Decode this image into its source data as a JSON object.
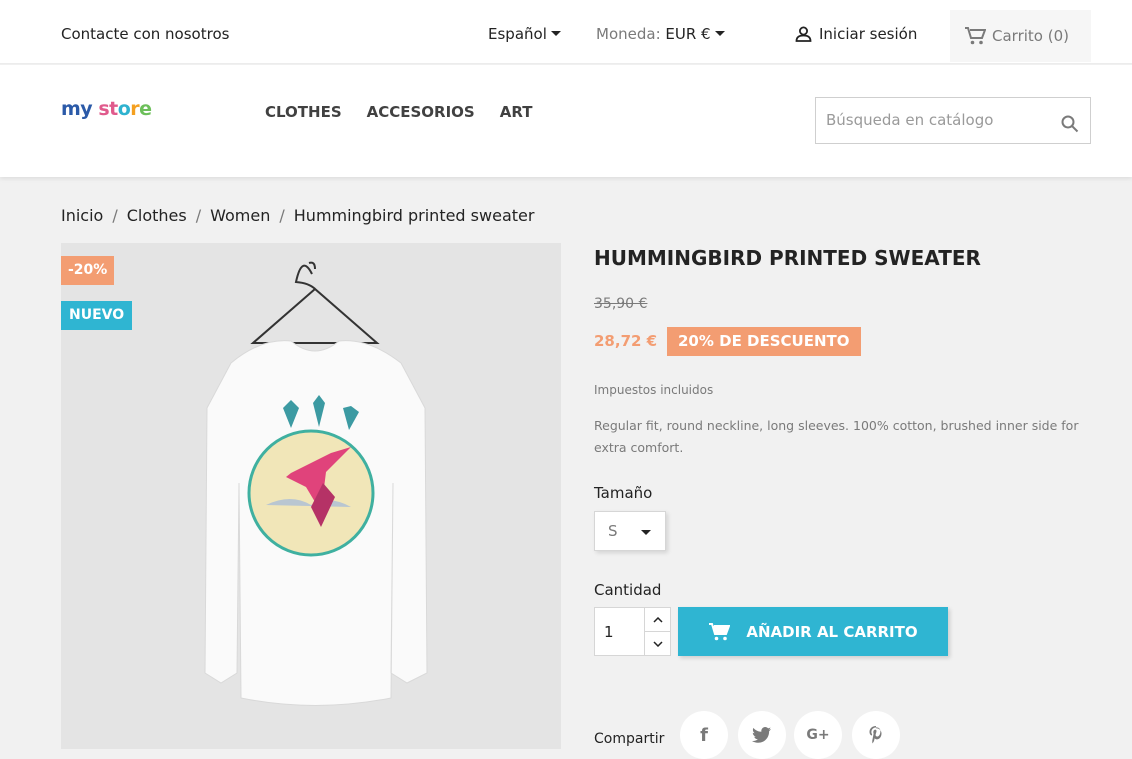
{
  "topbar": {
    "contact": "Contacte con nosotros",
    "language": "Español",
    "currency_label": "Moneda:",
    "currency_value": "EUR €",
    "signin": "Iniciar sesión",
    "cart": "Carrito (0)"
  },
  "header": {
    "logo": {
      "part1": "my",
      "part2": "st",
      "part3": "o",
      "part4": "r",
      "part5": "e"
    },
    "nav": [
      "CLOTHES",
      "ACCESORIOS",
      "ART"
    ],
    "search_placeholder": "Búsqueda en catálogo"
  },
  "breadcrumb": [
    "Inicio",
    "Clothes",
    "Women",
    "Hummingbird printed sweater"
  ],
  "product": {
    "badges": {
      "discount": "-20%",
      "new": "NUEVO"
    },
    "title": "HUMMINGBIRD PRINTED SWEATER",
    "old_price": "35,90 €",
    "new_price": "28,72 €",
    "discount_tag": "20% DE DESCUENTO",
    "tax": "Impuestos incluidos",
    "description": "Regular fit, round neckline, long sleeves. 100% cotton, brushed inner side for extra comfort.",
    "size_label": "Tamaño",
    "size_value": "S",
    "qty_label": "Cantidad",
    "qty_value": "1",
    "add_to_cart": "AÑADIR AL CARRITO",
    "share_label": "Compartir",
    "share_icons": {
      "facebook": "f",
      "googleplus": "G+"
    }
  },
  "colors": {
    "accent": "#2fb5d2",
    "discount": "#f39d72"
  }
}
